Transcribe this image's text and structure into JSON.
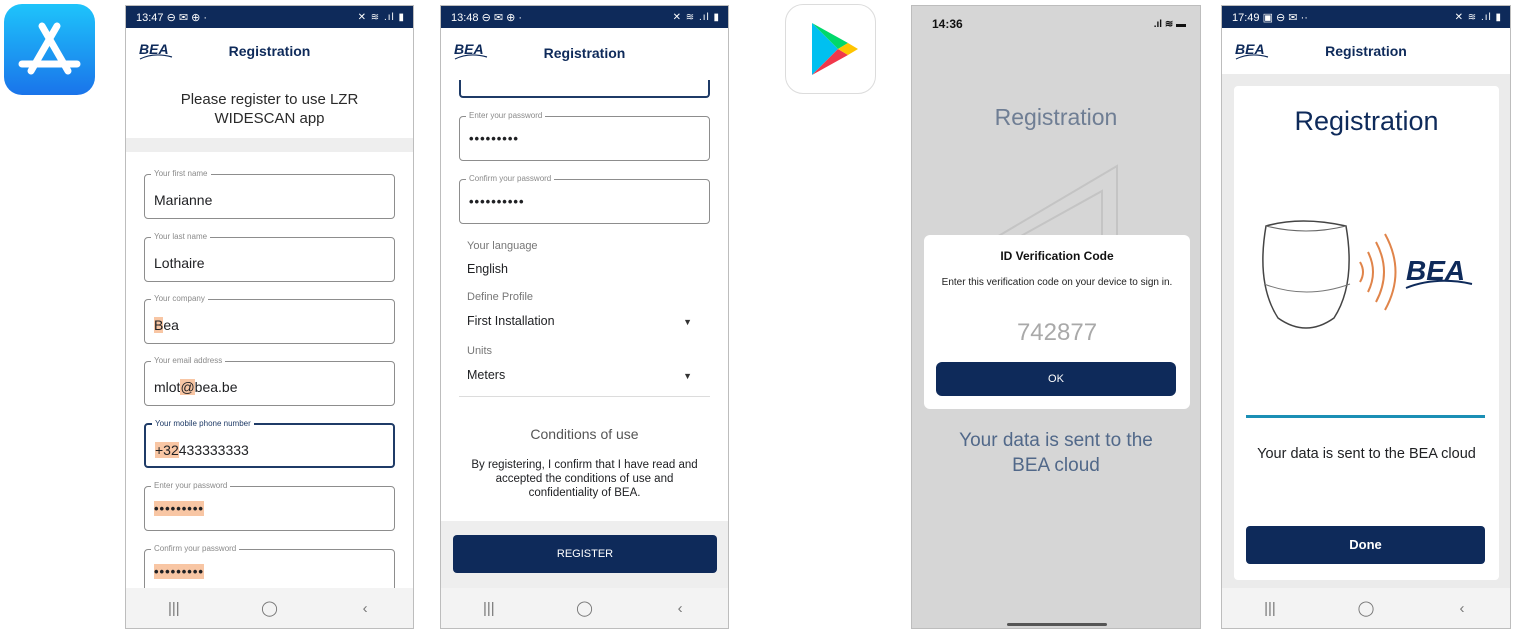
{
  "screen1": {
    "status_time": "13:47 ⊖ ✉ ⊕ ·",
    "status_sys": "✕ ≋ .ıl ▮",
    "appbar_title": "Registration",
    "heading": "Please register to use LZR WIDESCAN app",
    "fields": [
      {
        "label": "Your first name",
        "value": "Marianne"
      },
      {
        "label": "Your last name",
        "value": "Lothaire"
      },
      {
        "label": "Your company",
        "value_hl": "B",
        "value_rest": "ea"
      },
      {
        "label": "Your email address",
        "value_pre": "mlot",
        "value_hl": "@",
        "value_rest": "bea.be"
      },
      {
        "label": "Your mobile phone number",
        "value_hl": "+32",
        "value_rest": "433333333"
      },
      {
        "label": "Enter your password",
        "value_hl": "•••••••••"
      },
      {
        "label": "Confirm your password",
        "value_hl": "•••••••••"
      }
    ],
    "nav": [
      "|||",
      "◯",
      "‹"
    ]
  },
  "screen2": {
    "status_time": "13:48 ⊖ ✉ ⊕ ·",
    "status_sys": "✕ ≋ .ıl ▮",
    "appbar_title": "Registration",
    "fields": [
      {
        "label": "Enter your password",
        "value": "•••••••••"
      },
      {
        "label": "Confirm your password",
        "value": "••••••••••"
      }
    ],
    "language_label": "Your language",
    "language_value": "English",
    "profile_label": "Define Profile",
    "profile_value": "First Installation",
    "units_label": "Units",
    "units_value": "Meters",
    "conditions_title": "Conditions of use",
    "conditions_text": "By registering, I confirm that I have read and accepted the conditions of use and confidentiality of BEA.",
    "register_button": "REGISTER",
    "nav": [
      "|||",
      "◯",
      "‹"
    ]
  },
  "screen3": {
    "status_time": "14:36",
    "status_sys": ".ıl ≋ ▬",
    "title": "Registration",
    "dialog_title": "ID Verification Code",
    "dialog_text": "Enter this verification code on your device to sign in.",
    "code": "742877",
    "ok_button": "OK",
    "message": "Your data is sent to the BEA cloud"
  },
  "screen4": {
    "status_time": "17:49 ▣ ⊖ ✉ ··",
    "status_sys": "✕ ≋ .ıl ▮",
    "appbar_title": "Registration",
    "title": "Registration",
    "message": "Your data is sent to the BEA cloud",
    "done_button": "Done",
    "nav": [
      "|||",
      "◯",
      "‹"
    ]
  },
  "colors": {
    "navy": "#0e2a5a",
    "highlight": "#f8c6a4",
    "progress": "#1b8fb5",
    "appstore_blue": "#1a74ea"
  },
  "icons": [
    "app-store-icon",
    "google-play-icon",
    "bea-logo",
    "detector-sensor-icon"
  ]
}
